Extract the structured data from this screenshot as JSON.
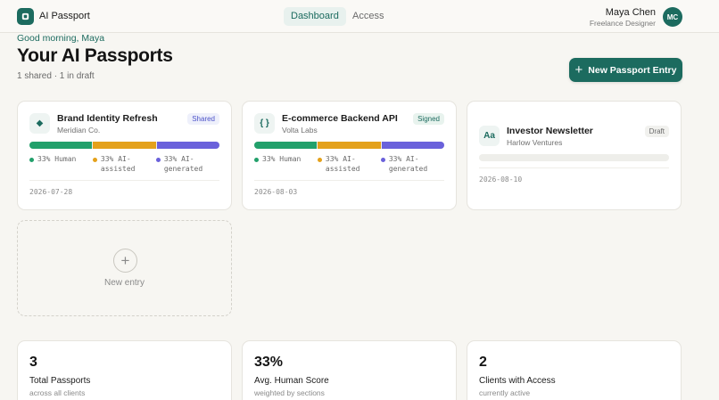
{
  "header": {
    "app_name": "AI Passport",
    "nav": [
      {
        "label": "Dashboard",
        "active": true
      },
      {
        "label": "Access",
        "active": false
      }
    ],
    "user": {
      "name": "Maya Chen",
      "role": "Freelance Designer",
      "initials": "MC"
    }
  },
  "main": {
    "greeting": "Good morning, Maya",
    "title": "Your AI Passports",
    "subtitle": "1 shared · 1 in draft",
    "new_button_label": "New Passport Entry"
  },
  "passports": [
    {
      "icon": "◆",
      "icon_name": "diamond-icon",
      "title": "Brand Identity Refresh",
      "client": "Meridian Co.",
      "status": "Shared",
      "human": 33,
      "assisted": 33,
      "generated": 33,
      "legend": {
        "human": "33% Human",
        "assisted": "33% AI-assisted",
        "generated": "33% AI-generated"
      },
      "date": "2026-07-28"
    },
    {
      "icon": "{ }",
      "icon_name": "code-braces-icon",
      "title": "E-commerce Backend API",
      "client": "Volta Labs",
      "status": "Signed",
      "human": 33,
      "assisted": 33,
      "generated": 33,
      "legend": {
        "human": "33% Human",
        "assisted": "33% AI-assisted",
        "generated": "33% AI-generated"
      },
      "date": "2026-08-03"
    },
    {
      "icon": "Aa",
      "icon_name": "text-type-icon",
      "title": "Investor Newsletter",
      "client": "Harlow Ventures",
      "status": "Draft",
      "date": "2026-08-10"
    }
  ],
  "new_entry_card": {
    "label": "New entry"
  },
  "stats": [
    {
      "value": "3",
      "label": "Total Passports",
      "sub": "across all clients"
    },
    {
      "value": "33%",
      "label": "Avg. Human Score",
      "sub": "weighted by sections"
    },
    {
      "value": "2",
      "label": "Clients with Access",
      "sub": "currently active"
    }
  ],
  "colors": {
    "accent": "#1c6b5f",
    "human": "#22a06b",
    "ai_assisted": "#e4a11b",
    "ai_generated": "#6a61db"
  }
}
